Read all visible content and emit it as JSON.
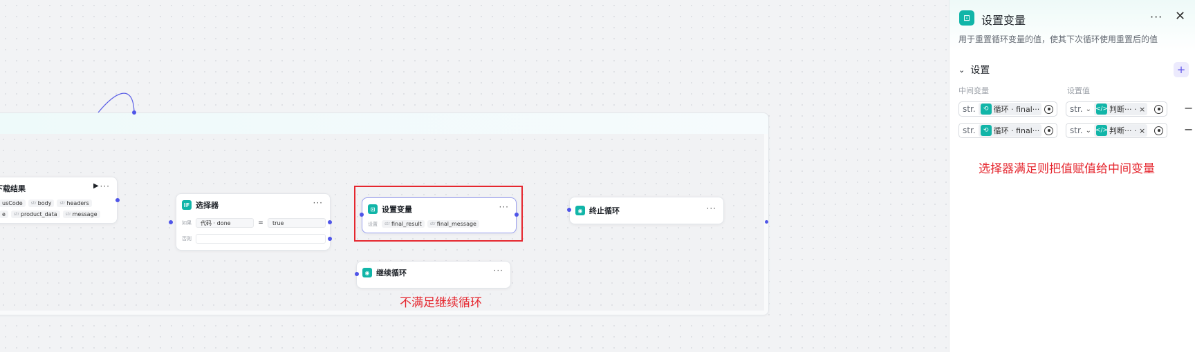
{
  "canvas": {
    "nodes": {
      "download": {
        "title": "下载结果",
        "title_visible": "下载结果",
        "row1": [
          "usCode",
          "body",
          "headers"
        ],
        "row2": [
          "e",
          "product_data",
          "message"
        ],
        "type_tag": "str"
      },
      "selector": {
        "title": "选择器",
        "icon": "IF",
        "if_label": "如果",
        "cond_left": "代码 · done",
        "cond_op": "=",
        "cond_right": "true",
        "else_label": "否则"
      },
      "set_var": {
        "title": "设置变量",
        "set_label": "设置",
        "vars": [
          "final_result",
          "final_message"
        ],
        "type_tag": "str"
      },
      "terminate": {
        "title": "终止循环"
      },
      "continue": {
        "title": "继续循环"
      }
    },
    "annotation_continue": "不满足继续循环",
    "more_glyph": "···"
  },
  "panel": {
    "title": "设置变量",
    "description": "用于重置循环变量的值，使其下次循环使用重置后的值",
    "section_label": "设置",
    "add_glyph": "+",
    "col_left": "中间变量",
    "col_right": "设置值",
    "rows": [
      {
        "type": "str.",
        "var": "循环 · final···",
        "value_type": "str.",
        "value": "判断··· · ×"
      },
      {
        "type": "str.",
        "var": "循环 · final···",
        "value_type": "str.",
        "value": "判断··· · ×"
      }
    ],
    "annotation": "选择器满足则把值赋值给中间变量",
    "colors": {
      "accent": "#11b5a8",
      "port": "#4f55e8",
      "annotation": "#e5262e"
    }
  }
}
